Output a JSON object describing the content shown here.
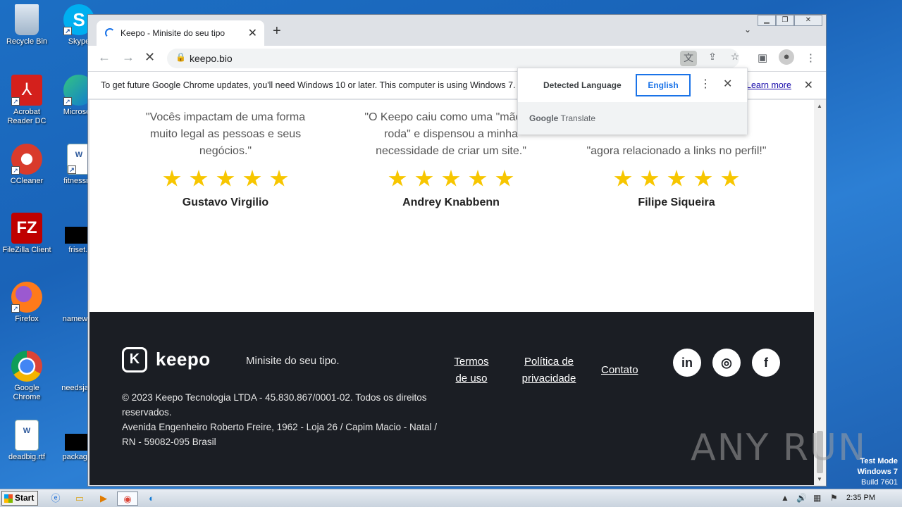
{
  "desktop": {
    "icons": [
      "Recycle Bin",
      "Skype",
      "Acrobat Reader DC",
      "Microsoft",
      "CCleaner",
      "fitnessmi",
      "FileZilla Client",
      "friset.j",
      "Firefox",
      "namewall",
      "Google Chrome",
      "needsjack",
      "deadbig.rtf",
      "packages"
    ]
  },
  "browser": {
    "tab_title": "Keepo - Minisite do seu tipo",
    "new_tab": "+",
    "url": "keepo.bio",
    "infobar_message": "To get future Google Chrome updates, you'll need Windows 10 or later. This computer is using Windows 7.",
    "infobar_link": "Learn more"
  },
  "translate_popup": {
    "detected_label": "Detected Language",
    "target_label": "English",
    "footer_brand": "Google",
    "footer_product": "Translate"
  },
  "page": {
    "testimonials": [
      {
        "quote": "\"Vocês impactam de uma forma muito legal as pessoas e seus negócios.\"",
        "rating": 5,
        "name": "Gustavo Virgilio"
      },
      {
        "quote": "\"O Keepo caiu como uma \"mão na roda\" e dispensou a minha necessidade de criar um site.\"",
        "rating": 5,
        "name": "Andrey Knabbenn"
      },
      {
        "quote": "\"agora relacionado a links no perfil!\"",
        "rating": 5,
        "name": "Filipe Siqueira"
      }
    ],
    "footer": {
      "brand": "keepo",
      "tagline": "Minisite do seu tipo.",
      "links": [
        "Termos de uso",
        "Política de privacidade",
        "Contato"
      ],
      "social": [
        "in",
        "◎",
        "f"
      ],
      "copyright": "© 2023 Keepo Tecnologia LTDA - 45.830.867/0001-02. Todos os direitos reservados.",
      "address": "Avenida Engenheiro Roberto Freire, 1962 - Loja 26 / Capim Macio - Natal / RN - 59082-095 Brasil"
    }
  },
  "taskbar": {
    "start_label": "Start",
    "clock": "2:35 PM"
  },
  "overlay": {
    "watermark": "ANY RUN",
    "testmode_title": "Test Mode",
    "testmode_os": "Windows 7",
    "testmode_build": "Build 7601"
  },
  "colors": {
    "accent": "#1a73e8",
    "star": "#f7c600",
    "footer_bg": "#1b1e24"
  }
}
